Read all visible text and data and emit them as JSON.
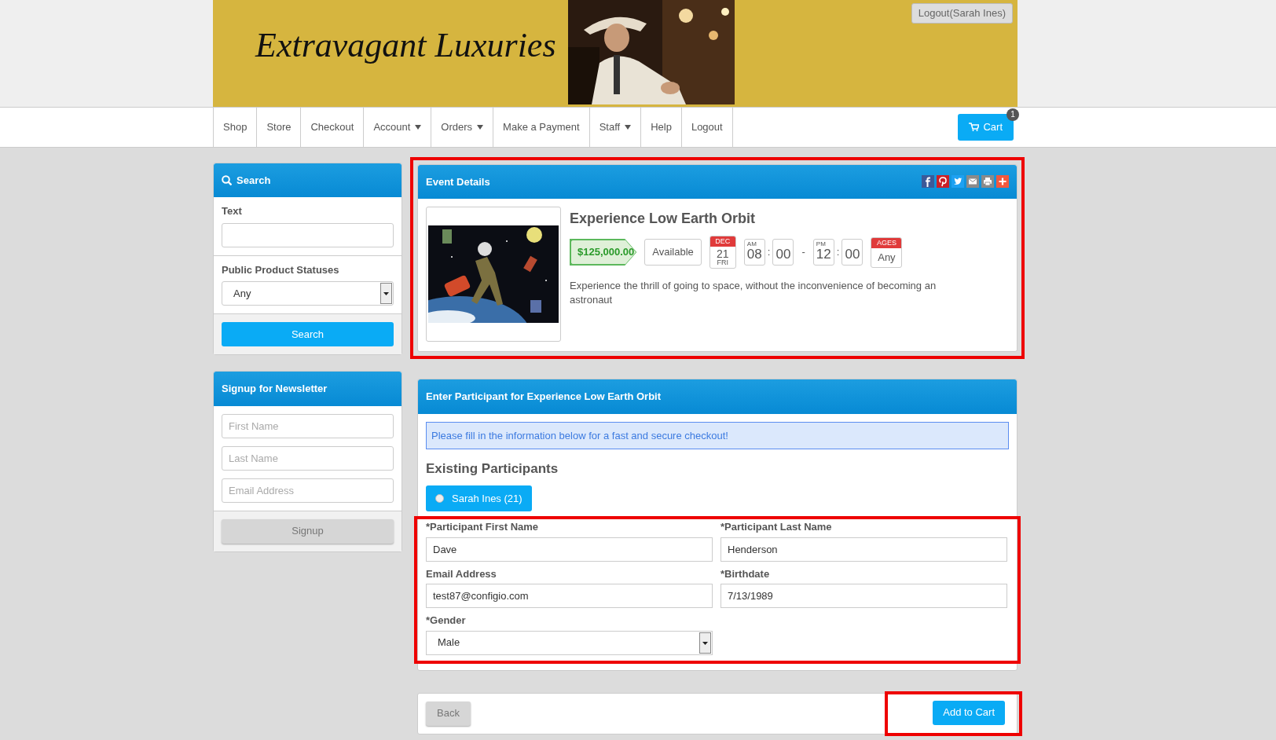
{
  "header": {
    "logo": "Extravagant Luxuries",
    "user_button": "Logout(Sarah Ines)"
  },
  "nav": {
    "items": [
      {
        "label": "Shop",
        "dropdown": false
      },
      {
        "label": "Store",
        "dropdown": false
      },
      {
        "label": "Checkout",
        "dropdown": false
      },
      {
        "label": "Account",
        "dropdown": true
      },
      {
        "label": "Orders",
        "dropdown": true
      },
      {
        "label": "Make a Payment",
        "dropdown": false
      },
      {
        "label": "Staff",
        "dropdown": true
      },
      {
        "label": "Help",
        "dropdown": false
      },
      {
        "label": "Logout",
        "dropdown": false
      }
    ],
    "cart": {
      "label": "Cart",
      "count": "1"
    }
  },
  "search_panel": {
    "title": "Search",
    "fields": [
      {
        "kind": "text",
        "label": "Text"
      },
      {
        "kind": "select",
        "label": "Public Product Statuses",
        "value": "Any"
      }
    ],
    "button": "Search"
  },
  "newsletter": {
    "title": "Signup for Newsletter",
    "fields": [
      {
        "placeholder": "First Name"
      },
      {
        "placeholder": "Last Name"
      },
      {
        "placeholder": "Email Address"
      }
    ],
    "button": "Signup"
  },
  "event": {
    "title": "Event Details",
    "highlighted": true,
    "name": "Experience Low Earth Orbit",
    "price": "$125,000.00",
    "availability": "Available",
    "date": {
      "month": "DEC",
      "day": "21",
      "weekday": "FRI"
    },
    "start": {
      "period": "AM",
      "hour": "08",
      "separator": ":",
      "minute": "00"
    },
    "range_separator": "-",
    "end": {
      "period": "PM",
      "hour": "12",
      "separator": ":",
      "minute": "00"
    },
    "ages": {
      "label": "AGES",
      "value": "Any"
    },
    "description": "Experience the thrill of going to space, without the inconvenience of becoming an astronaut"
  },
  "participant": {
    "title": "Enter Participant for Experience Low Earth Orbit",
    "alert": "Please fill in the information below for a fast and secure checkout!",
    "existing_title": "Existing Participants",
    "existing": [
      {
        "label": "Sarah Ines (21)",
        "selected": false
      }
    ],
    "fields_highlighted": true,
    "fields": [
      {
        "kind": "text",
        "label": "*Participant First Name",
        "value": "Dave"
      },
      {
        "kind": "text",
        "label": "*Participant Last Name",
        "value": "Henderson"
      },
      {
        "kind": "text",
        "label": "Email Address",
        "value": "test87@configio.com"
      },
      {
        "kind": "text",
        "label": "*Birthdate",
        "value": "7/13/1989"
      },
      {
        "kind": "select",
        "label": "*Gender",
        "value": "Male"
      }
    ]
  },
  "footer": {
    "back": "Back",
    "add": "Add to Cart",
    "add_highlighted": true
  }
}
